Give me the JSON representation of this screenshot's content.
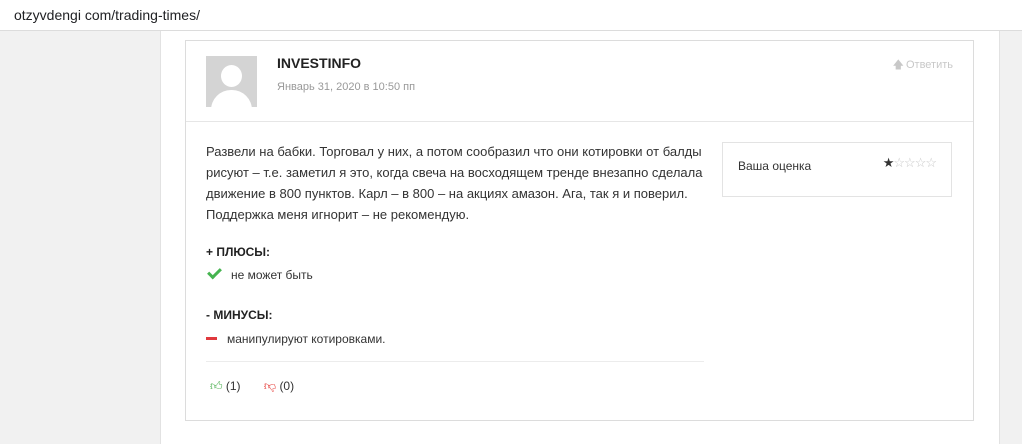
{
  "browser": {
    "url": "otzyvdengi com/trading-times/"
  },
  "comment": {
    "author": "INVESTINFO",
    "date": "Январь 31, 2020 в 10:50 пп",
    "reply_label": "Ответить",
    "text": "Развели на бабки. Торговал у них, а потом сообразил что они котировки от балды рисуют – т.е. заметил я это, когда свеча на восходящем тренде внезапно сделала движение в 800 пунктов. Карл – в 800 – на акциях амазон. Ага, так я и поверил. Поддержка меня игнорит – не рекомендую.",
    "pros_heading": "+ ПЛЮСЫ:",
    "pros": [
      "не может быть"
    ],
    "cons_heading": "- МИНУСЫ:",
    "cons": [
      "манипулируют котировками."
    ],
    "likes": "(1)",
    "dislikes": "(0)"
  },
  "rating": {
    "label": "Ваша оценка",
    "value": 1,
    "max": 5,
    "star_color": "#c9c9c9"
  },
  "colors": {
    "pros_icon": "#46b450",
    "cons_icon": "#e0393e",
    "like": "#4caf50",
    "dislike": "#e53935"
  }
}
